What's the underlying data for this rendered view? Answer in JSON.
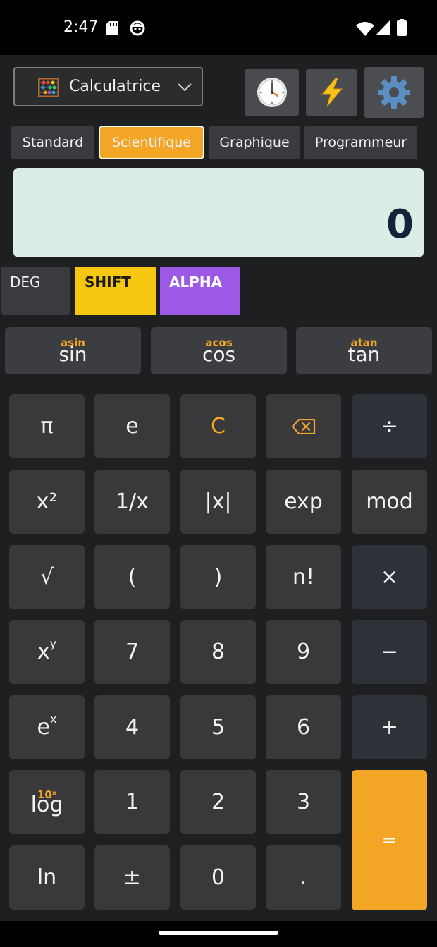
{
  "status_bar": {
    "time": "2:47",
    "icons": [
      "sd-card-icon",
      "face-icon",
      "wifi-icon",
      "signal-icon",
      "battery-icon"
    ]
  },
  "header": {
    "app_selector": {
      "icon": "abacus-icon",
      "label": "Calculatrice"
    },
    "tools": [
      {
        "name": "history",
        "icon": "clock-icon"
      },
      {
        "name": "quick",
        "icon": "lightning-icon"
      },
      {
        "name": "settings",
        "icon": "gear-icon"
      }
    ]
  },
  "tabs": [
    {
      "label": "Standard",
      "active": false
    },
    {
      "label": "Scientifique",
      "active": true
    },
    {
      "label": "Graphique",
      "active": false
    },
    {
      "label": "Programmeur",
      "active": false
    }
  ],
  "display": {
    "value": "0"
  },
  "modes": {
    "angle": "DEG",
    "shift": "SHIFT",
    "alpha": "ALPHA"
  },
  "trig": [
    {
      "alt": "asin",
      "main": "sin"
    },
    {
      "alt": "acos",
      "main": "cos"
    },
    {
      "alt": "atan",
      "main": "tan"
    }
  ],
  "keys": {
    "pi": "π",
    "e": "e",
    "clear": "C",
    "divide": "÷",
    "square": "x²",
    "reciprocal": "1/x",
    "abs": "|x|",
    "exp": "exp",
    "mod": "mod",
    "sqrt": "√",
    "lparen": "(",
    "rparen": ")",
    "factorial": "n!",
    "multiply": "×",
    "power_base": "x",
    "power_sup": "y",
    "seven": "7",
    "eight": "8",
    "nine": "9",
    "minus": "−",
    "exp_base": "e",
    "exp_sup": "x",
    "four": "4",
    "five": "5",
    "six": "6",
    "plus": "+",
    "log_alt": "10ˣ",
    "log": "log",
    "one": "1",
    "two": "2",
    "three": "3",
    "equals": "=",
    "ln": "ln",
    "negate": "±",
    "zero": "0",
    "dot": "."
  },
  "colors": {
    "accent": "#f3a626",
    "shift": "#f5c711",
    "alpha": "#9b59e6",
    "display_bg": "#dcede5",
    "display_text": "#16223a",
    "key_bg": "#39393b",
    "operator_bg": "#2e3137"
  }
}
